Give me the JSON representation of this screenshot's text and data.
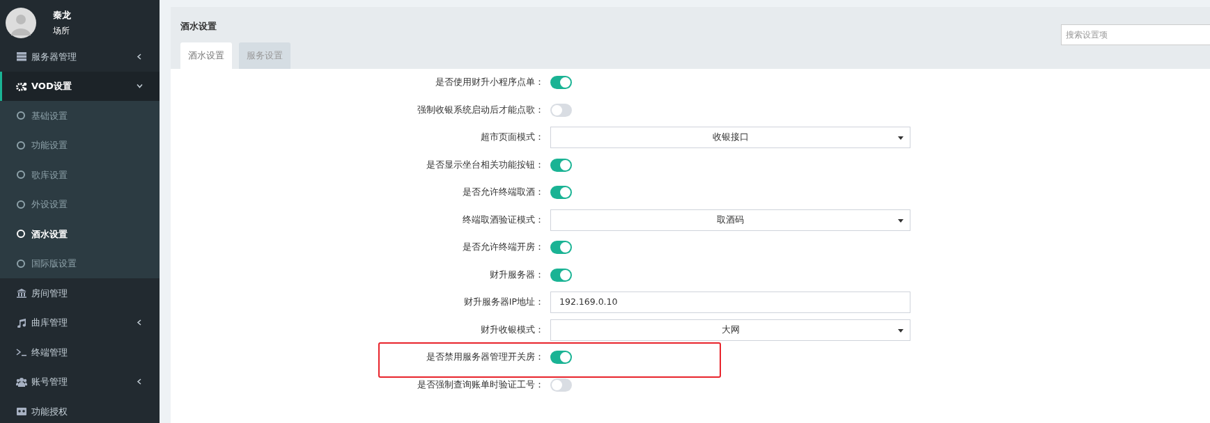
{
  "user": {
    "name": "秦龙",
    "role": "场所"
  },
  "sidebar": {
    "items": [
      {
        "label": "服务器管理",
        "collapsible": true,
        "expanded": false
      },
      {
        "label": "VOD设置",
        "collapsible": true,
        "expanded": true,
        "children": [
          {
            "label": "基础设置",
            "selected": false
          },
          {
            "label": "功能设置",
            "selected": false
          },
          {
            "label": "歌库设置",
            "selected": false
          },
          {
            "label": "外设设置",
            "selected": false
          },
          {
            "label": "酒水设置",
            "selected": true
          },
          {
            "label": "国际版设置",
            "selected": false
          }
        ]
      },
      {
        "label": "房间管理",
        "collapsible": false,
        "expanded": false
      },
      {
        "label": "曲库管理",
        "collapsible": true,
        "expanded": false
      },
      {
        "label": "终端管理",
        "collapsible": false,
        "expanded": false
      },
      {
        "label": "账号管理",
        "collapsible": true,
        "expanded": false
      },
      {
        "label": "功能授权",
        "collapsible": false,
        "expanded": false
      }
    ]
  },
  "panel": {
    "title": "酒水设置",
    "search": {
      "placeholder": "搜索设置项"
    },
    "tabs": [
      {
        "label": "酒水设置",
        "selected": true
      },
      {
        "label": "服务设置",
        "selected": false
      }
    ],
    "settings": [
      {
        "label": "是否使用财升小程序点单：",
        "kind": "toggle",
        "on": true,
        "highlighted": false
      },
      {
        "label": "强制收银系统启动后才能点歌：",
        "kind": "toggle",
        "on": false,
        "highlighted": false
      },
      {
        "label": "超市页面模式：",
        "kind": "select",
        "value": "收银接口",
        "highlighted": false
      },
      {
        "label": "是否显示坐台相关功能按钮：",
        "kind": "toggle",
        "on": true,
        "highlighted": false
      },
      {
        "label": "是否允许终端取酒：",
        "kind": "toggle",
        "on": true,
        "highlighted": false
      },
      {
        "label": "终端取酒验证模式：",
        "kind": "select",
        "value": "取酒码",
        "highlighted": false
      },
      {
        "label": "是否允许终端开房：",
        "kind": "toggle",
        "on": true,
        "highlighted": false
      },
      {
        "label": "财升服务器：",
        "kind": "toggle",
        "on": true,
        "highlighted": false
      },
      {
        "label": "财升服务器IP地址：",
        "kind": "text",
        "value": "192.169.0.10",
        "highlighted": false
      },
      {
        "label": "财升收银模式：",
        "kind": "select",
        "value": "大网",
        "highlighted": false
      },
      {
        "label": "是否禁用服务器管理开关房：",
        "kind": "toggle",
        "on": true,
        "highlighted": true
      },
      {
        "label": "是否强制查询账单时验证工号：",
        "kind": "toggle",
        "on": false,
        "highlighted": false
      }
    ]
  }
}
